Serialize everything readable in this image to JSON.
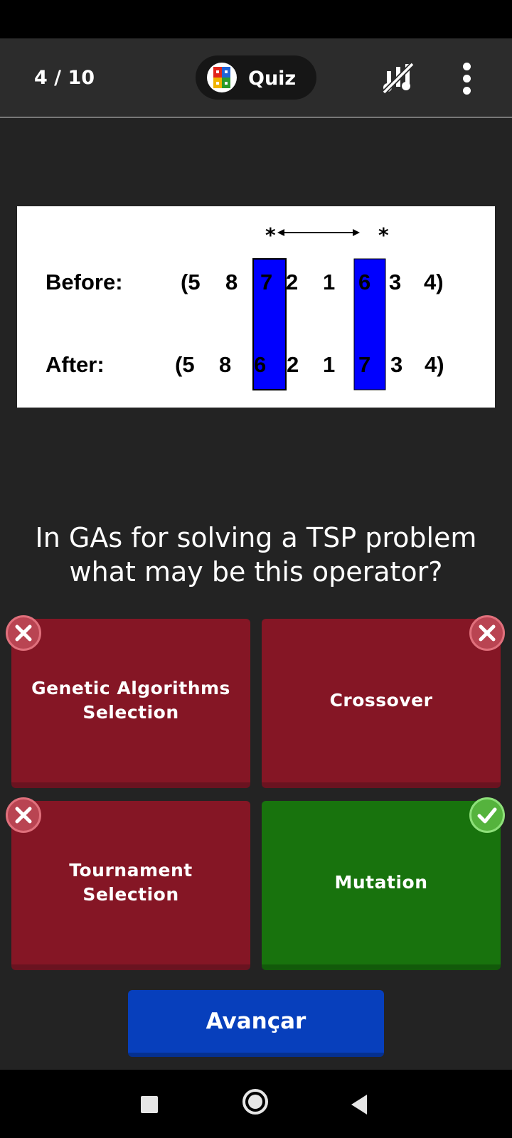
{
  "header": {
    "progress": "4 / 10",
    "quiz_label": "Quiz"
  },
  "figure": {
    "before_label": "Before:",
    "after_label": "After:",
    "before_seq": [
      "(5",
      "8",
      "7",
      "2",
      "1",
      "6",
      "3",
      "4)"
    ],
    "after_seq": [
      "(5",
      "8",
      "6",
      "2",
      "1",
      "7",
      "3",
      "4)"
    ],
    "marker": "*",
    "highlight_color": "#0000ff"
  },
  "question": "In GAs for solving a TSP problem what may be this operator?",
  "answers": [
    {
      "label": "Genetic Algorithms Selection",
      "status": "wrong"
    },
    {
      "label": "Crossover",
      "status": "wrong"
    },
    {
      "label": "Tournament Selection",
      "status": "wrong"
    },
    {
      "label": "Mutation",
      "status": "correct"
    }
  ],
  "next_button": "Avançar",
  "colors": {
    "wrong": "#851625",
    "correct": "#18730d",
    "primary": "#073fbc"
  },
  "icons": {
    "music_off": "music-off-icon",
    "menu": "more-vertical-icon",
    "wrong_badge": "close-icon",
    "correct_badge": "check-icon"
  }
}
